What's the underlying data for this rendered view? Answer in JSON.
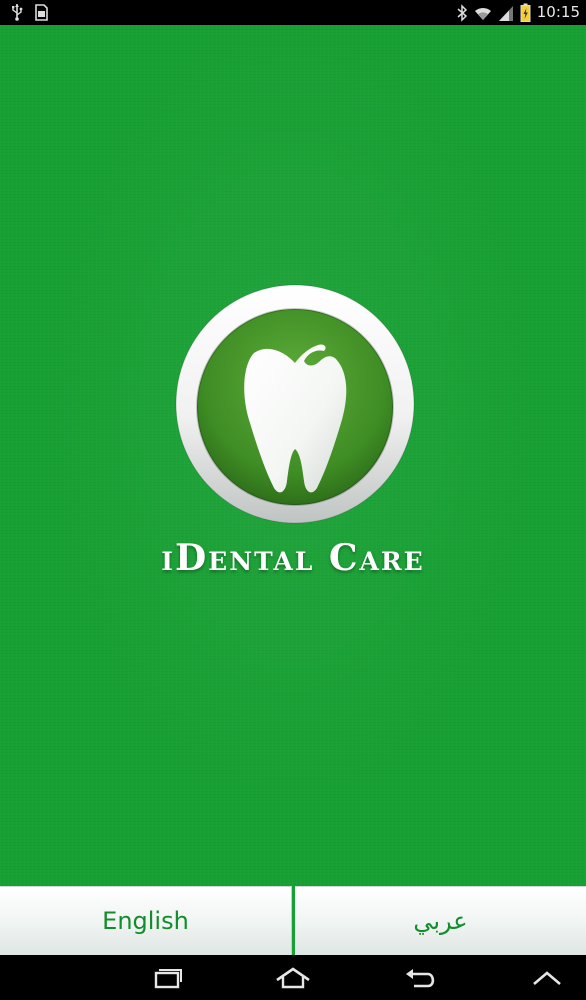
{
  "status_bar": {
    "time": "10:15",
    "icons_left": [
      "usb-icon",
      "sd-card-icon"
    ],
    "icons_right": [
      "bluetooth-icon",
      "wifi-icon",
      "signal-icon",
      "battery-icon"
    ]
  },
  "splash": {
    "app_name": "iDental Care",
    "logo_icon": "tooth-icon",
    "background_color": "#17a033"
  },
  "language_buttons": {
    "english_label": "English",
    "arabic_label": "عربي",
    "text_color": "#138d2c"
  },
  "nav_bar": {
    "icons": [
      "recent-apps-icon",
      "home-icon",
      "back-icon",
      "up-arrow-icon"
    ]
  }
}
